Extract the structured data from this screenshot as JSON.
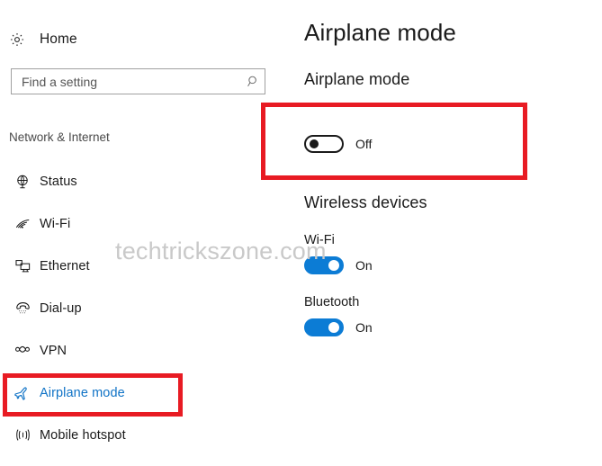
{
  "window": {
    "accent_color": "#0a76d2",
    "selected_color": "#1073c6",
    "annotation_color": "#e81b23",
    "toggle_on_color": "#0c7cd5"
  },
  "sidebar": {
    "home": {
      "label": "Home",
      "icon": "gear-icon"
    },
    "search": {
      "placeholder": "Find a setting",
      "value": "",
      "icon": "search-icon"
    },
    "group_title": "Network & Internet",
    "items": [
      {
        "label": "Status",
        "icon": "globe-icon",
        "selected": false
      },
      {
        "label": "Wi-Fi",
        "icon": "wifi-icon",
        "selected": false
      },
      {
        "label": "Ethernet",
        "icon": "ethernet-icon",
        "selected": false
      },
      {
        "label": "Dial-up",
        "icon": "dialup-phone-icon",
        "selected": false
      },
      {
        "label": "VPN",
        "icon": "vpn-icon",
        "selected": false
      },
      {
        "label": "Airplane mode",
        "icon": "airplane-icon",
        "selected": true
      },
      {
        "label": "Mobile hotspot",
        "icon": "hotspot-icon",
        "selected": false
      }
    ]
  },
  "main": {
    "page_title": "Airplane mode",
    "airplane_section": {
      "heading": "Airplane mode",
      "toggle": {
        "state": "Off",
        "on": false
      }
    },
    "wireless_section": {
      "heading": "Wireless devices",
      "devices": [
        {
          "label": "Wi-Fi",
          "state": "On",
          "on": true
        },
        {
          "label": "Bluetooth",
          "state": "On",
          "on": true
        }
      ]
    }
  },
  "watermark": {
    "text": "techtrickszone.com"
  }
}
